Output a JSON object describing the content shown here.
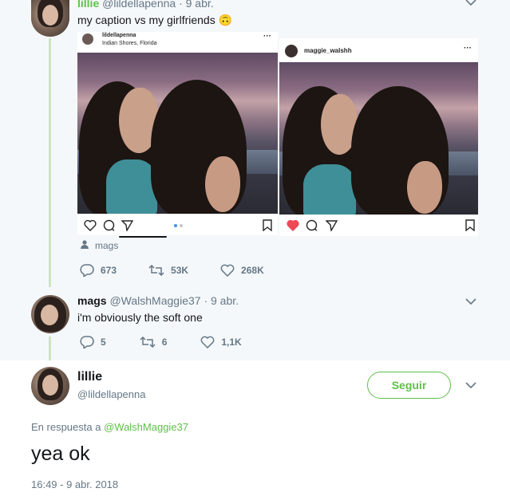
{
  "tweet1": {
    "name": "lillie",
    "handle": "@lildellapenna",
    "date": "· 9 abr.",
    "text": "my caption vs my girlfriends",
    "emoji": "🙃",
    "tagged": "mags",
    "counts": {
      "replies": "673",
      "retweets": "53K",
      "likes": "268K"
    },
    "ig_left": {
      "username": "lildellapenna",
      "location": "Indian Shores, Florida"
    },
    "ig_right": {
      "username": "maggie_walshh"
    }
  },
  "tweet2": {
    "name": "mags",
    "handle": "@WalshMaggie37",
    "date": "· 9 abr.",
    "text": "i'm obviously the soft one",
    "counts": {
      "replies": "5",
      "retweets": "6",
      "likes": "1,1K"
    }
  },
  "main": {
    "name": "lillie",
    "handle": "@lildellapenna",
    "follow_label": "Seguir",
    "reply_prefix": "En respuesta a",
    "reply_handle": "@WalshMaggie37",
    "text": "yea ok",
    "timestamp": "16:49 - 9 abr. 2018"
  },
  "colors": {
    "accent": "#5fbf4a",
    "muted": "#657786",
    "thread_bg": "#f5f8fa"
  },
  "icons": [
    "reply-icon",
    "retweet-icon",
    "like-icon",
    "chevron-down-icon",
    "person-icon",
    "instagram-like-icon",
    "instagram-comment-icon",
    "instagram-share-icon",
    "instagram-bookmark-icon"
  ]
}
